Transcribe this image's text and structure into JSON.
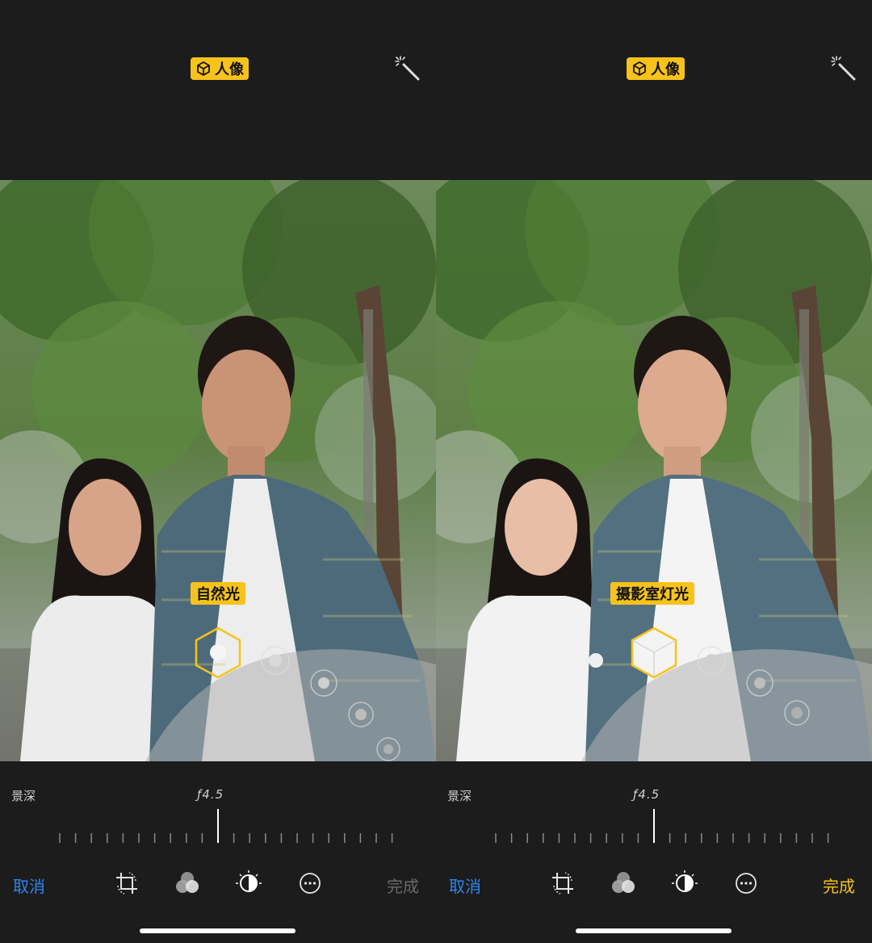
{
  "screens": [
    {
      "mode_badge": "人像",
      "lighting_label": "自然光",
      "depth": {
        "label": "景深",
        "value": "ƒ4.5"
      },
      "toolbar": {
        "cancel": "取消",
        "done": "完成",
        "done_enabled": false
      }
    },
    {
      "mode_badge": "人像",
      "lighting_label": "摄影室灯光",
      "depth": {
        "label": "景深",
        "value": "ƒ4.5"
      },
      "toolbar": {
        "cancel": "取消",
        "done": "完成",
        "done_enabled": true
      }
    }
  ],
  "icons": [
    "cube-icon",
    "magic-wand-icon",
    "crop-rotate-icon",
    "filters-icon",
    "adjust-dial-icon",
    "more-icon"
  ],
  "colors": {
    "accent_yellow": "#f7c31a",
    "cancel_blue": "#2e86f0",
    "done_disabled": "#6a6a6a",
    "background": "#1c1c1d"
  }
}
